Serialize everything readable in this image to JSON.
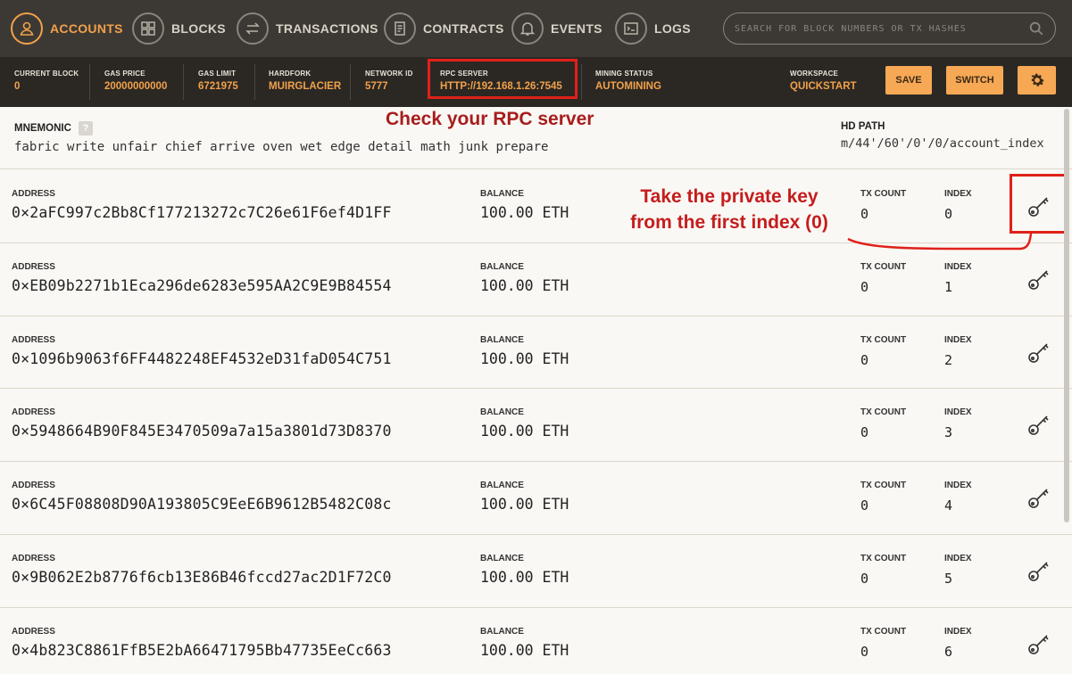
{
  "nav": {
    "items": [
      {
        "label": "ACCOUNTS",
        "icon": "accounts-icon"
      },
      {
        "label": "BLOCKS",
        "icon": "blocks-icon"
      },
      {
        "label": "TRANSACTIONS",
        "icon": "transactions-icon"
      },
      {
        "label": "CONTRACTS",
        "icon": "contracts-icon"
      },
      {
        "label": "EVENTS",
        "icon": "events-icon"
      },
      {
        "label": "LOGS",
        "icon": "logs-icon"
      }
    ],
    "search_placeholder": "SEARCH FOR BLOCK NUMBERS OR TX HASHES"
  },
  "status": {
    "current_block": {
      "label": "CURRENT BLOCK",
      "value": "0"
    },
    "gas_price": {
      "label": "GAS PRICE",
      "value": "20000000000"
    },
    "gas_limit": {
      "label": "GAS LIMIT",
      "value": "6721975"
    },
    "hardfork": {
      "label": "HARDFORK",
      "value": "MUIRGLACIER"
    },
    "network_id": {
      "label": "NETWORK ID",
      "value": "5777"
    },
    "rpc_server": {
      "label": "RPC SERVER",
      "value": "HTTP://192.168.1.26:7545"
    },
    "mining_status": {
      "label": "MINING STATUS",
      "value": "AUTOMINING"
    },
    "workspace": {
      "label": "WORKSPACE",
      "value": "QUICKSTART"
    },
    "save_label": "SAVE",
    "switch_label": "SWITCH"
  },
  "mnemonic": {
    "label": "MNEMONIC",
    "help": "?",
    "words": "fabric write unfair chief arrive oven wet edge detail math junk prepare",
    "hd_path_label": "HD PATH",
    "hd_path": "m/44'/60'/0'/0/account_index"
  },
  "annotations": {
    "rpc": "Check your  RPC server",
    "key_line1": "Take the private key",
    "key_line2": "from the first index (0)"
  },
  "labels": {
    "address": "ADDRESS",
    "balance": "BALANCE",
    "tx_count": "TX COUNT",
    "index": "INDEX"
  },
  "accounts": [
    {
      "address": "0×2aFC997c2Bb8Cf177213272c7C26e61F6ef4D1FF",
      "balance": "100.00 ETH",
      "tx_count": "0",
      "index": "0"
    },
    {
      "address": "0×EB09b2271b1Eca296de6283e595AA2C9E9B84554",
      "balance": "100.00 ETH",
      "tx_count": "0",
      "index": "1"
    },
    {
      "address": "0×1096b9063f6FF4482248EF4532eD31faD054C751",
      "balance": "100.00 ETH",
      "tx_count": "0",
      "index": "2"
    },
    {
      "address": "0×5948664B90F845E3470509a7a15a3801d73D8370",
      "balance": "100.00 ETH",
      "tx_count": "0",
      "index": "3"
    },
    {
      "address": "0×6C45F08808D90A193805C9EeE6B9612B5482C08c",
      "balance": "100.00 ETH",
      "tx_count": "0",
      "index": "4"
    },
    {
      "address": "0×9B062E2b8776f6cb13E86B46fccd27ac2D1F72C0",
      "balance": "100.00 ETH",
      "tx_count": "0",
      "index": "5"
    },
    {
      "address": "0×4b823C8861FfB5E2bA66471795Bb47735EeCc663",
      "balance": "100.00 ETH",
      "tx_count": "0",
      "index": "6"
    }
  ],
  "colors": {
    "accent": "#f2a14a",
    "nav_bg": "#3c3934",
    "status_bg": "#2b2824",
    "annotation_red": "#c41d1d"
  }
}
